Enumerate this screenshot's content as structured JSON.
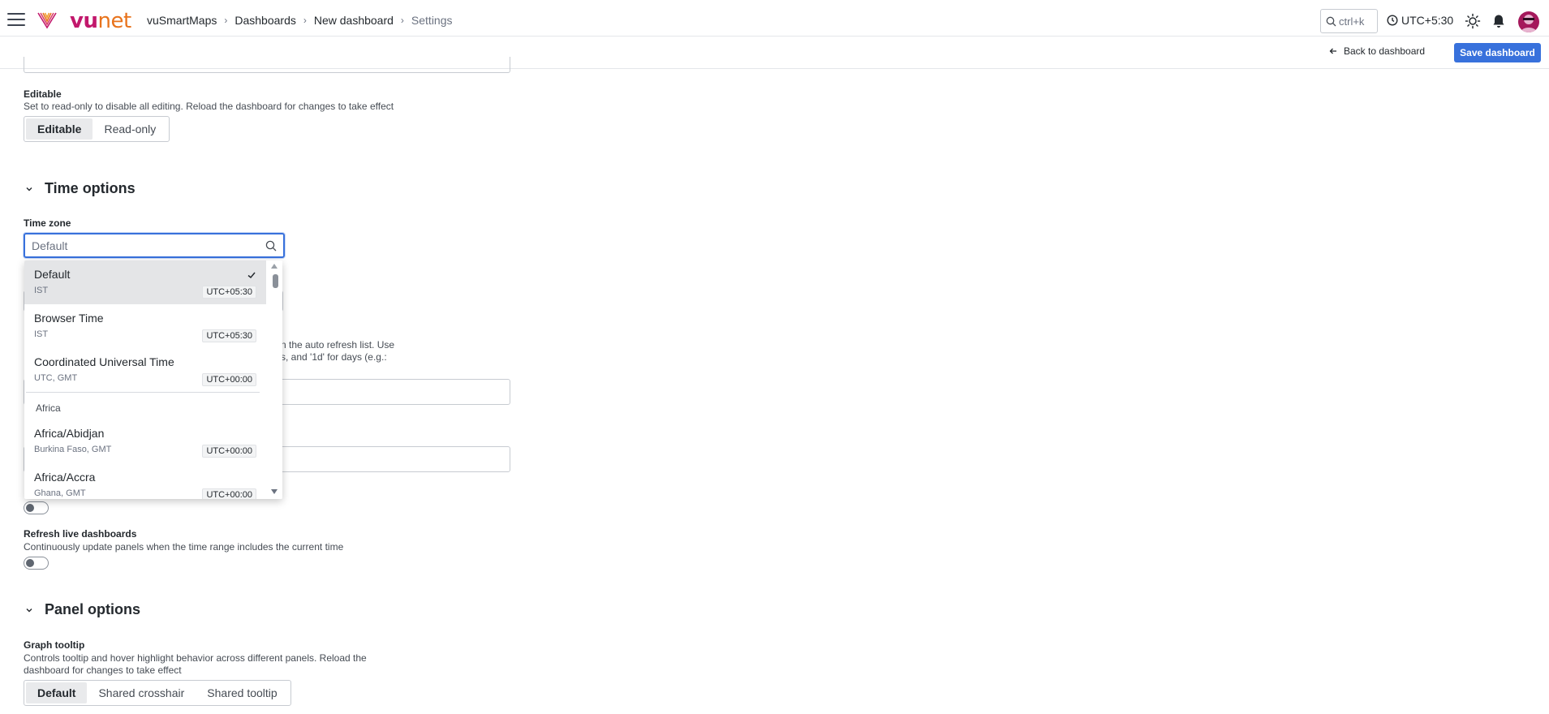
{
  "header": {
    "logo_text_a": "vu",
    "logo_text_b": "net",
    "breadcrumbs": [
      "vuSmartMaps",
      "Dashboards",
      "New dashboard",
      "Settings"
    ],
    "search_shortcut": "ctrl+k",
    "timezone_label": "UTC+5:30"
  },
  "subbar": {
    "back_label": "Back to dashboard",
    "save_label": "Save dashboard"
  },
  "editable": {
    "label": "Editable",
    "description": "Set to read-only to disable all editing. Reload the dashboard for changes to take effect",
    "options": [
      "Editable",
      "Read-only"
    ],
    "selected": "Editable"
  },
  "time_options": {
    "title": "Time options",
    "timezone_label": "Time zone",
    "timezone_placeholder": "Default",
    "refresh_desc_line1": "n the auto refresh list. Use",
    "refresh_desc_line2": "s, and '1d' for days (e.g.:",
    "refresh_live": {
      "label": "Refresh live dashboards",
      "description": "Continuously update panels when the time range includes the current time"
    }
  },
  "timezone_dropdown": {
    "items": [
      {
        "name": "Default",
        "sub": "IST",
        "offset": "UTC+05:30",
        "selected": true
      },
      {
        "name": "Browser Time",
        "sub": "IST",
        "offset": "UTC+05:30"
      },
      {
        "name": "Coordinated Universal Time",
        "sub": "UTC, GMT",
        "offset": "UTC+00:00"
      }
    ],
    "group": "Africa",
    "group_items": [
      {
        "name": "Africa/Abidjan",
        "sub": "Burkina Faso, GMT",
        "offset": "UTC+00:00"
      },
      {
        "name": "Africa/Accra",
        "sub": "Ghana, GMT",
        "offset": "UTC+00:00"
      }
    ]
  },
  "panel_options": {
    "title": "Panel options",
    "tooltip_label": "Graph tooltip",
    "tooltip_desc_line1": "Controls tooltip and hover highlight behavior across different panels. Reload the",
    "tooltip_desc_line2": "dashboard for changes to take effect",
    "options": [
      "Default",
      "Shared crosshair",
      "Shared tooltip"
    ],
    "selected": "Default"
  },
  "colors": {
    "accent": "#3871dc",
    "brand_magenta": "#c2186c",
    "brand_orange": "#e8731c"
  }
}
